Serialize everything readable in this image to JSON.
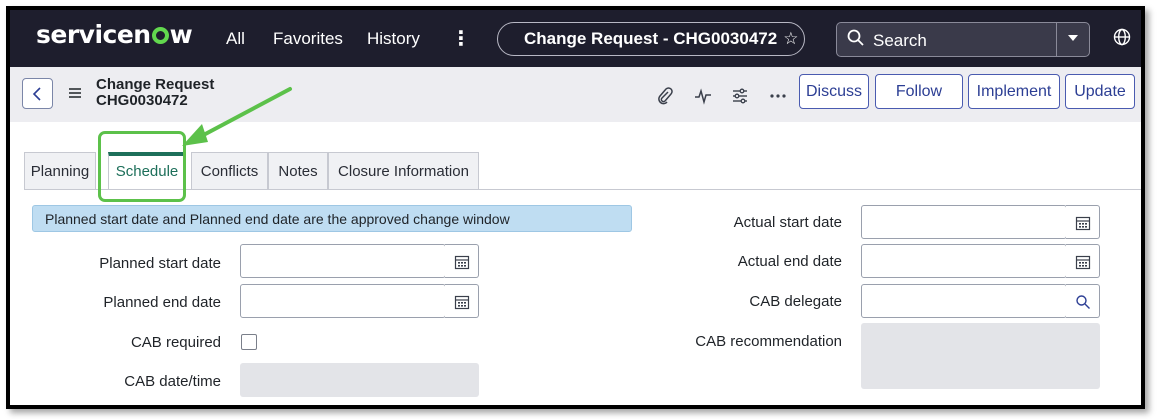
{
  "colors": {
    "topbar_bg": "#1e1e2d",
    "brand_green": "#62d84e",
    "active_tab": "#1d6f5a",
    "button_text": "#2c3e94",
    "banner_bg": "#bfddf2",
    "highlight_green": "#5cc14a"
  },
  "topbar": {
    "logo_pre": "servicen",
    "logo_post": "w",
    "nav": [
      "All",
      "Favorites",
      "History"
    ],
    "more_icon": "vertical-dots-icon",
    "record_title": "Change Request - CHG0030472",
    "favorite_icon": "star-outline-icon",
    "search_placeholder": "Search",
    "search_icon": "magnifier-icon",
    "dropdown_icon": "caret-down-icon",
    "globe_icon": "globe-icon"
  },
  "header": {
    "back_icon": "chevron-left-icon",
    "menu_icon": "hamburger-icon",
    "title": "Change Request",
    "number": "CHG0030472",
    "icons": [
      "paperclip-icon",
      "activity-icon",
      "sliders-icon",
      "more-horizontal-icon"
    ],
    "buttons": [
      "Discuss",
      "Follow",
      "Implement",
      "Update"
    ]
  },
  "tabs": [
    {
      "label": "Planning",
      "active": false
    },
    {
      "label": "Schedule",
      "active": true
    },
    {
      "label": "Conflicts",
      "active": false
    },
    {
      "label": "Notes",
      "active": false
    },
    {
      "label": "Closure Information",
      "active": false
    }
  ],
  "form": {
    "info_banner": "Planned start date and Planned end date are the approved change window",
    "left": {
      "planned_start_label": "Planned start date",
      "planned_start_value": "",
      "planned_end_label": "Planned end date",
      "planned_end_value": "",
      "cab_required_label": "CAB required",
      "cab_required_checked": false,
      "cab_datetime_label": "CAB date/time",
      "cab_datetime_value": ""
    },
    "right": {
      "actual_start_label": "Actual start date",
      "actual_start_value": "",
      "actual_end_label": "Actual end date",
      "actual_end_value": "",
      "cab_delegate_label": "CAB delegate",
      "cab_delegate_value": "",
      "cab_recommendation_label": "CAB recommendation",
      "cab_recommendation_value": ""
    },
    "calendar_icon": "calendar-icon",
    "lookup_icon": "magnifier-icon"
  }
}
